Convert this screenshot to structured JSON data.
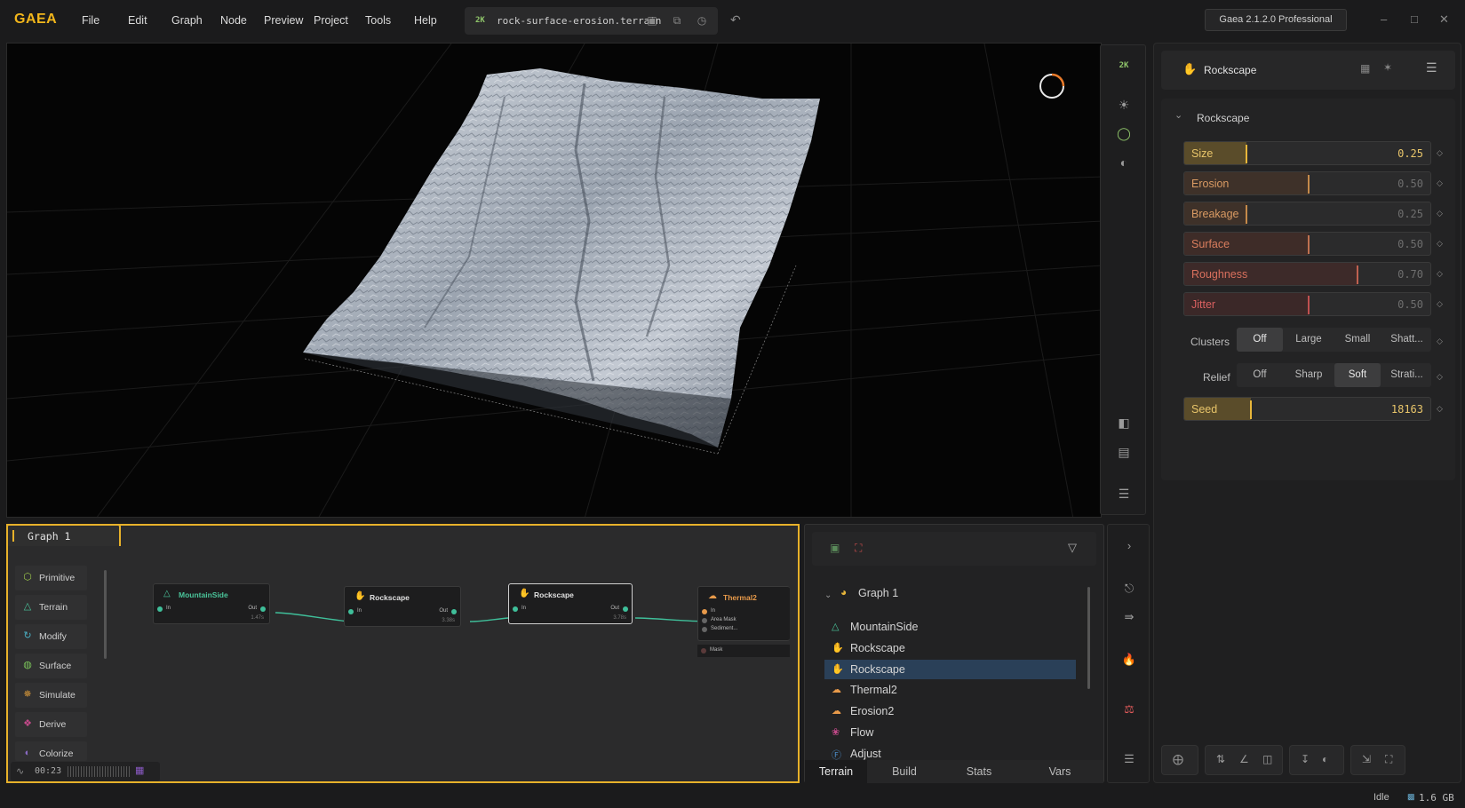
{
  "app": {
    "logo": "GAEA",
    "menu": [
      "File",
      "Edit",
      "Graph",
      "Node",
      "Preview",
      "Project",
      "Tools",
      "Help"
    ],
    "file": {
      "resolution": "2K",
      "name": "rock-surface-erosion.terrain"
    },
    "version": "Gaea 2.1.2.0 Professional"
  },
  "viewport": {
    "resolution_badge": "2K"
  },
  "properties": {
    "header_title": "Rockscape",
    "section_title": "Rockscape",
    "sliders": [
      {
        "label": "Size",
        "value": "0.25",
        "fraction": 0.25,
        "color": "#e8b63a",
        "fill": "#5a4c2a",
        "label_color": "#e8c56a"
      },
      {
        "label": "Erosion",
        "value": "0.50",
        "fraction": 0.5,
        "color": "#c58a4a",
        "fill": "#3e3129",
        "label_color": "#d99a63"
      },
      {
        "label": "Breakage",
        "value": "0.25",
        "fraction": 0.25,
        "color": "#c58a4a",
        "fill": "#3e3129",
        "label_color": "#d99a63"
      },
      {
        "label": "Surface",
        "value": "0.50",
        "fraction": 0.5,
        "color": "#c07050",
        "fill": "#3e2c28",
        "label_color": "#d97d5d"
      },
      {
        "label": "Roughness",
        "value": "0.70",
        "fraction": 0.7,
        "color": "#c06050",
        "fill": "#3d2a29",
        "label_color": "#d9705d"
      },
      {
        "label": "Jitter",
        "value": "0.50",
        "fraction": 0.5,
        "color": "#c05050",
        "fill": "#3b2828",
        "label_color": "#d96060"
      }
    ],
    "clusters": {
      "label": "Clusters",
      "options": [
        "Off",
        "Large",
        "Small",
        "Shatt..."
      ],
      "selected": 0
    },
    "relief": {
      "label": "Relief",
      "options": [
        "Off",
        "Sharp",
        "Soft",
        "Strati..."
      ],
      "selected": 2
    },
    "seed": {
      "label": "Seed",
      "value": "18163",
      "fraction": 0.27,
      "color": "#e8b63a",
      "fill": "#5a4c2a",
      "label_color": "#e8c56a"
    }
  },
  "graph": {
    "tab": "Graph 1",
    "library": [
      {
        "name": "Primitive",
        "icon": "cube-icon",
        "color": "#9ac44a"
      },
      {
        "name": "Terrain",
        "icon": "mountain-icon",
        "color": "#4ac49a"
      },
      {
        "name": "Modify",
        "icon": "modify-icon",
        "color": "#4ab0c4"
      },
      {
        "name": "Surface",
        "icon": "surface-icon",
        "color": "#7ac45a"
      },
      {
        "name": "Simulate",
        "icon": "simulate-icon",
        "color": "#e8a23a"
      },
      {
        "name": "Derive",
        "icon": "derive-icon",
        "color": "#c44a8a"
      },
      {
        "name": "Colorize",
        "icon": "colorize-icon",
        "color": "#8a6ac4"
      }
    ],
    "nodes": [
      {
        "title": "MountainSide",
        "color": "#4ac49a",
        "in": "In",
        "out": "Out",
        "time": "1.47s"
      },
      {
        "title": "Rockscape",
        "color": "#e0e0e0",
        "in": "In",
        "out": "Out",
        "time": "3.38s"
      },
      {
        "title": "Rockscape",
        "color": "#e0e0e0",
        "in": "In",
        "out": "Out",
        "time": "3.78s"
      },
      {
        "title": "Thermal2",
        "color": "#e89a4a",
        "in": "In",
        "ports": [
          "Area Mask",
          "Sediment..."
        ],
        "mask": "Mask"
      }
    ],
    "timer": "00:23"
  },
  "tree": {
    "root": "Graph 1",
    "items": [
      {
        "name": "MountainSide",
        "icon": "mountain-icon",
        "color": "#4ac49a"
      },
      {
        "name": "Rockscape",
        "icon": "hand-icon",
        "color": "#d0d0d0"
      },
      {
        "name": "Rockscape",
        "icon": "hand-icon",
        "color": "#d0d0d0",
        "selected": true
      },
      {
        "name": "Thermal2",
        "icon": "thermal-icon",
        "color": "#e89a4a"
      },
      {
        "name": "Erosion2",
        "icon": "erosion-icon",
        "color": "#e89a4a"
      },
      {
        "name": "Flow",
        "icon": "flow-icon",
        "color": "#c44a8a"
      },
      {
        "name": "Adjust",
        "icon": "fx-icon",
        "color": "#4a8ac4"
      }
    ],
    "tabs": [
      "Terrain",
      "Build",
      "Stats",
      "Vars"
    ],
    "active_tab": 0
  },
  "status": {
    "state": "Idle",
    "memory": "1.6 GB"
  }
}
